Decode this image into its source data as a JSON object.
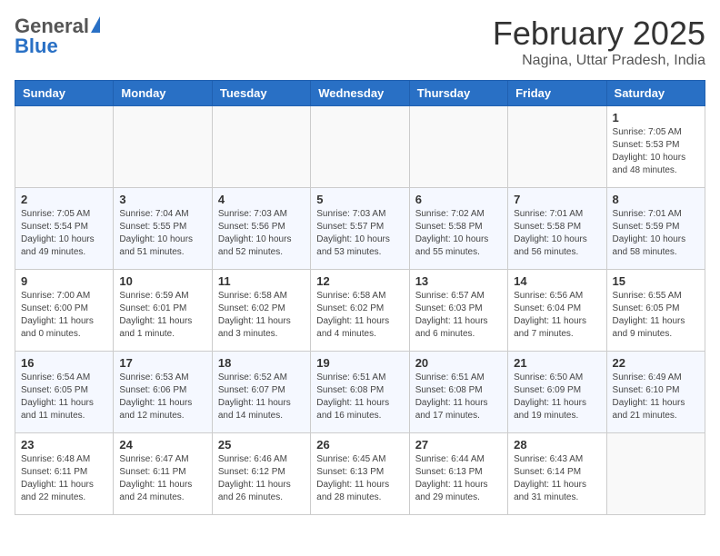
{
  "header": {
    "logo_general": "General",
    "logo_blue": "Blue",
    "title": "February 2025",
    "subtitle": "Nagina, Uttar Pradesh, India"
  },
  "weekdays": [
    "Sunday",
    "Monday",
    "Tuesday",
    "Wednesday",
    "Thursday",
    "Friday",
    "Saturday"
  ],
  "weeks": [
    [
      {
        "day": "",
        "info": ""
      },
      {
        "day": "",
        "info": ""
      },
      {
        "day": "",
        "info": ""
      },
      {
        "day": "",
        "info": ""
      },
      {
        "day": "",
        "info": ""
      },
      {
        "day": "",
        "info": ""
      },
      {
        "day": "1",
        "info": "Sunrise: 7:05 AM\nSunset: 5:53 PM\nDaylight: 10 hours and 48 minutes."
      }
    ],
    [
      {
        "day": "2",
        "info": "Sunrise: 7:05 AM\nSunset: 5:54 PM\nDaylight: 10 hours and 49 minutes."
      },
      {
        "day": "3",
        "info": "Sunrise: 7:04 AM\nSunset: 5:55 PM\nDaylight: 10 hours and 51 minutes."
      },
      {
        "day": "4",
        "info": "Sunrise: 7:03 AM\nSunset: 5:56 PM\nDaylight: 10 hours and 52 minutes."
      },
      {
        "day": "5",
        "info": "Sunrise: 7:03 AM\nSunset: 5:57 PM\nDaylight: 10 hours and 53 minutes."
      },
      {
        "day": "6",
        "info": "Sunrise: 7:02 AM\nSunset: 5:58 PM\nDaylight: 10 hours and 55 minutes."
      },
      {
        "day": "7",
        "info": "Sunrise: 7:01 AM\nSunset: 5:58 PM\nDaylight: 10 hours and 56 minutes."
      },
      {
        "day": "8",
        "info": "Sunrise: 7:01 AM\nSunset: 5:59 PM\nDaylight: 10 hours and 58 minutes."
      }
    ],
    [
      {
        "day": "9",
        "info": "Sunrise: 7:00 AM\nSunset: 6:00 PM\nDaylight: 11 hours and 0 minutes."
      },
      {
        "day": "10",
        "info": "Sunrise: 6:59 AM\nSunset: 6:01 PM\nDaylight: 11 hours and 1 minute."
      },
      {
        "day": "11",
        "info": "Sunrise: 6:58 AM\nSunset: 6:02 PM\nDaylight: 11 hours and 3 minutes."
      },
      {
        "day": "12",
        "info": "Sunrise: 6:58 AM\nSunset: 6:02 PM\nDaylight: 11 hours and 4 minutes."
      },
      {
        "day": "13",
        "info": "Sunrise: 6:57 AM\nSunset: 6:03 PM\nDaylight: 11 hours and 6 minutes."
      },
      {
        "day": "14",
        "info": "Sunrise: 6:56 AM\nSunset: 6:04 PM\nDaylight: 11 hours and 7 minutes."
      },
      {
        "day": "15",
        "info": "Sunrise: 6:55 AM\nSunset: 6:05 PM\nDaylight: 11 hours and 9 minutes."
      }
    ],
    [
      {
        "day": "16",
        "info": "Sunrise: 6:54 AM\nSunset: 6:05 PM\nDaylight: 11 hours and 11 minutes."
      },
      {
        "day": "17",
        "info": "Sunrise: 6:53 AM\nSunset: 6:06 PM\nDaylight: 11 hours and 12 minutes."
      },
      {
        "day": "18",
        "info": "Sunrise: 6:52 AM\nSunset: 6:07 PM\nDaylight: 11 hours and 14 minutes."
      },
      {
        "day": "19",
        "info": "Sunrise: 6:51 AM\nSunset: 6:08 PM\nDaylight: 11 hours and 16 minutes."
      },
      {
        "day": "20",
        "info": "Sunrise: 6:51 AM\nSunset: 6:08 PM\nDaylight: 11 hours and 17 minutes."
      },
      {
        "day": "21",
        "info": "Sunrise: 6:50 AM\nSunset: 6:09 PM\nDaylight: 11 hours and 19 minutes."
      },
      {
        "day": "22",
        "info": "Sunrise: 6:49 AM\nSunset: 6:10 PM\nDaylight: 11 hours and 21 minutes."
      }
    ],
    [
      {
        "day": "23",
        "info": "Sunrise: 6:48 AM\nSunset: 6:11 PM\nDaylight: 11 hours and 22 minutes."
      },
      {
        "day": "24",
        "info": "Sunrise: 6:47 AM\nSunset: 6:11 PM\nDaylight: 11 hours and 24 minutes."
      },
      {
        "day": "25",
        "info": "Sunrise: 6:46 AM\nSunset: 6:12 PM\nDaylight: 11 hours and 26 minutes."
      },
      {
        "day": "26",
        "info": "Sunrise: 6:45 AM\nSunset: 6:13 PM\nDaylight: 11 hours and 28 minutes."
      },
      {
        "day": "27",
        "info": "Sunrise: 6:44 AM\nSunset: 6:13 PM\nDaylight: 11 hours and 29 minutes."
      },
      {
        "day": "28",
        "info": "Sunrise: 6:43 AM\nSunset: 6:14 PM\nDaylight: 11 hours and 31 minutes."
      },
      {
        "day": "",
        "info": ""
      }
    ]
  ]
}
